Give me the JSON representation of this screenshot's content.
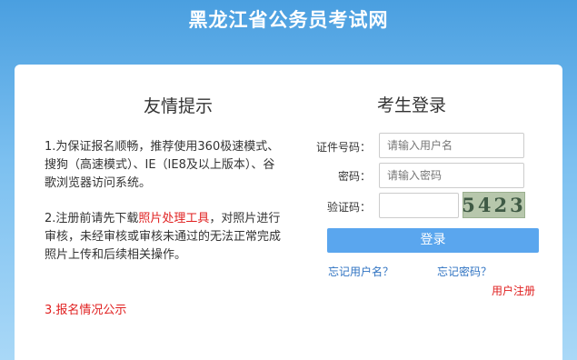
{
  "header": {
    "title": "黑龙江省公务员考试网"
  },
  "tips": {
    "title": "友情提示",
    "item1": "1.为保证报名顺畅，推荐使用360极速模式、搜狗（高速模式）、IE（IE8及以上版本）、谷歌浏览器访问系统。",
    "item2_prefix": "2.注册前请先下载",
    "item2_link": "照片处理工具",
    "item2_suffix": "，对照片进行审核，未经审核或审核未通过的无法正常完成照片上传和后续相关操作。",
    "item3": "3.报名情况公示"
  },
  "login": {
    "title": "考生登录",
    "id_label": "证件号码：",
    "id_placeholder": "请输入用户名",
    "password_label": "密码：",
    "password_placeholder": "请输入密码",
    "captcha_label": "验证码：",
    "captcha_text": "5423",
    "submit_label": "登录",
    "forgot_username": "忘记用户名？",
    "forgot_password": "忘记密码？",
    "register": "用户注册"
  },
  "colors": {
    "accent": "#5aa6ee",
    "link": "#2f73c2",
    "warning_red": "#e02020"
  }
}
